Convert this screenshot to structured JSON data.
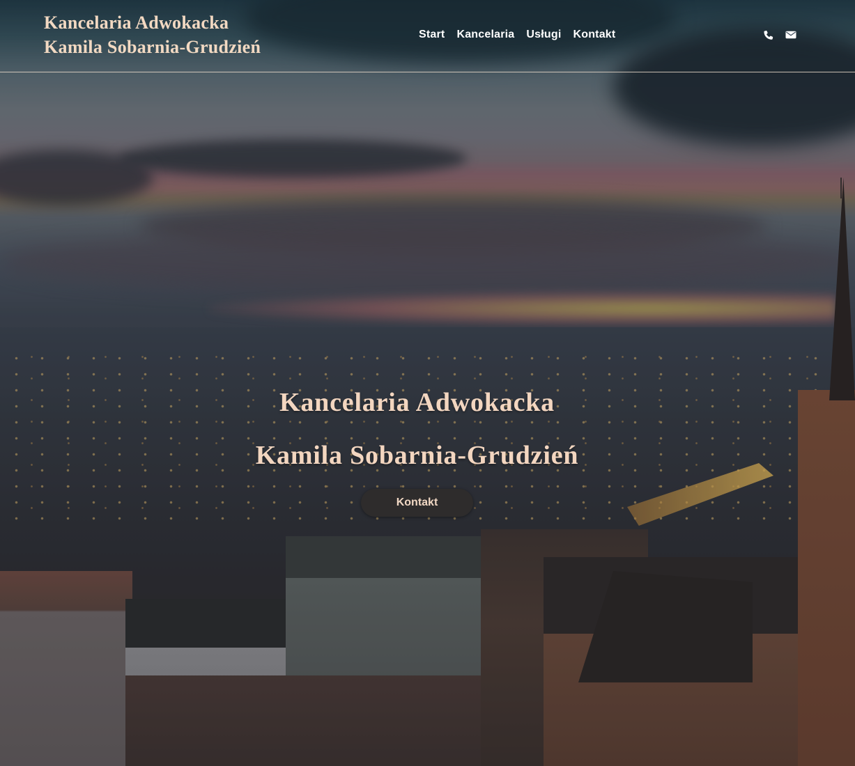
{
  "header": {
    "brand_line1": "Kancelaria Adwokacka",
    "brand_line2": "Kamila Sobarnia-Grudzień",
    "nav": [
      {
        "label": "Start"
      },
      {
        "label": "Kancelaria"
      },
      {
        "label": "Usługi"
      },
      {
        "label": "Kontakt"
      }
    ],
    "icons": [
      "phone-icon",
      "envelope-icon"
    ]
  },
  "hero": {
    "title_line1": "Kancelaria Adwokacka",
    "title_line2": "Kamila Sobarnia-Grudzień",
    "cta_label": "Kontakt"
  },
  "colors": {
    "accent_text": "#f3d6c0",
    "button_bg": "#2e2c2c",
    "nav_text": "#ffffff"
  }
}
